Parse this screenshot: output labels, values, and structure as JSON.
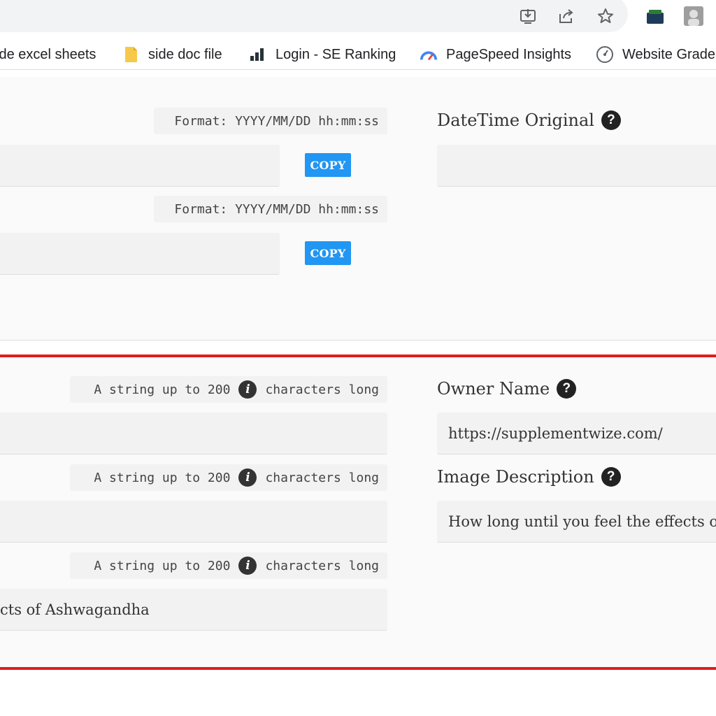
{
  "browser": {
    "bookmarks": [
      {
        "label": "ide excel sheets",
        "icon": "spreadsheet-icon"
      },
      {
        "label": "side doc file",
        "icon": "doc-file-icon"
      },
      {
        "label": "Login - SE Ranking",
        "icon": "se-ranking-icon"
      },
      {
        "label": "PageSpeed Insights",
        "icon": "pagespeed-icon"
      },
      {
        "label": "Website Grade",
        "icon": "speedometer-icon"
      }
    ],
    "toolbar_icons": [
      "install-app-icon",
      "share-icon",
      "star-icon",
      "extension-icon",
      "profile-avatar-icon"
    ]
  },
  "datetime_section": {
    "format_hint": "Format: YYYY/MM/DD hh:mm:ss",
    "copy_label": "COPY",
    "datetime_original_label": "DateTime Original",
    "fields": [
      "",
      "",
      ""
    ]
  },
  "string_section": {
    "hint_prefix": "A string up to 200",
    "hint_suffix": "characters long",
    "info_glyph": "i",
    "left_fields": [
      "",
      "",
      "cts of Ashwagandha"
    ],
    "owner_name_label": "Owner Name",
    "owner_name_value": "https://supplementwize.com/",
    "image_description_label": "Image Description",
    "image_description_value": "How long until you feel the effects of"
  },
  "help_glyph": "?",
  "colors": {
    "copy_button": "#2196f3",
    "highlight_border": "#e31b1b",
    "field_bg": "#f2f2f2"
  }
}
